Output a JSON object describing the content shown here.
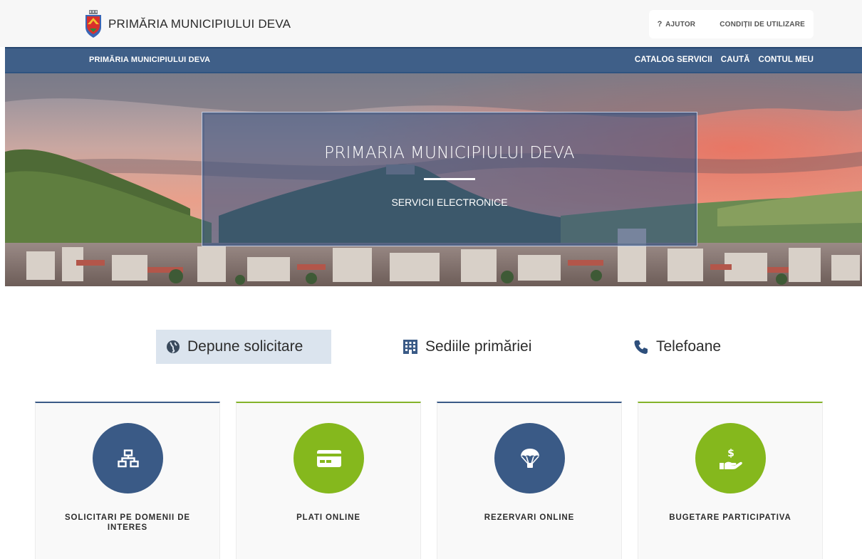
{
  "header": {
    "brand_name": "PRIMĂRIA MUNICIPIULUI DEVA",
    "help_label": "AJUTOR",
    "terms_label": "CONDIȚII DE UTILIZARE"
  },
  "nav": {
    "brand": "PRIMĂRIA MUNICIPIULUI DEVA",
    "links": [
      {
        "label": "CATALOG SERVICII"
      },
      {
        "label": "CAUTĂ"
      },
      {
        "label": "CONTUL MEU"
      }
    ]
  },
  "hero": {
    "title": "PRIMARIA MUNICIPIULUI DEVA",
    "subtitle": "SERVICII ELECTRONICE"
  },
  "tabs": [
    {
      "label": "Depune solicitare",
      "icon": "globe-icon",
      "active": true
    },
    {
      "label": "Sediile primăriei",
      "icon": "building-icon",
      "active": false
    },
    {
      "label": "Telefoane",
      "icon": "phone-icon",
      "active": false
    }
  ],
  "cards": [
    {
      "label": "SOLICITARI PE DOMENII DE INTERES",
      "icon": "network-icon",
      "color": "#3a5a86"
    },
    {
      "label": "PLATI ONLINE",
      "icon": "credit-card-icon",
      "color": "#85b81d"
    },
    {
      "label": "REZERVARI ONLINE",
      "icon": "parachute-icon",
      "color": "#3a5a86"
    },
    {
      "label": "BUGETARE PARTICIPATIVA",
      "icon": "hand-money-icon",
      "color": "#85b81d"
    }
  ],
  "colors": {
    "navy": "#3f5f88",
    "green": "#85b81d",
    "active_tab_bg": "#dbe4ee"
  }
}
